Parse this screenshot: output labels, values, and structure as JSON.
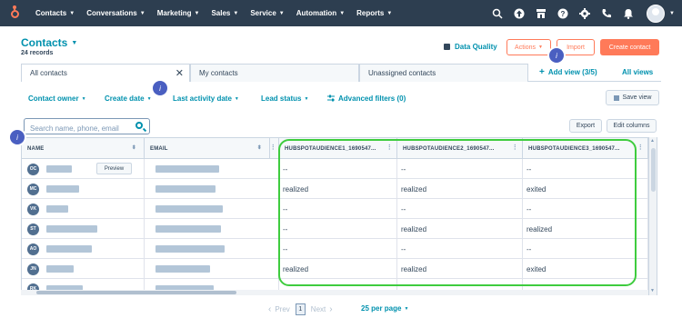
{
  "nav": {
    "items": [
      {
        "label": "Contacts"
      },
      {
        "label": "Conversations"
      },
      {
        "label": "Marketing"
      },
      {
        "label": "Sales"
      },
      {
        "label": "Service"
      },
      {
        "label": "Automation"
      },
      {
        "label": "Reports"
      }
    ],
    "icons": [
      "search-icon",
      "upgrade-icon",
      "marketplace-icon",
      "help-icon",
      "settings-icon",
      "calling-icon",
      "notifications-icon"
    ]
  },
  "header": {
    "title": "Contacts",
    "record_count": "24 records",
    "data_quality": "Data Quality",
    "actions": "Actions",
    "import": "Import",
    "create_contact": "Create contact"
  },
  "tabs": [
    {
      "label": "All contacts",
      "active": true
    },
    {
      "label": "My contacts",
      "active": false
    },
    {
      "label": "Unassigned contacts",
      "active": false
    }
  ],
  "views": {
    "add_view": "Add view (3/5)",
    "all_views": "All views"
  },
  "filters": {
    "contact_owner": "Contact owner",
    "create_date": "Create date",
    "last_activity_date": "Last activity date",
    "lead_status": "Lead status",
    "advanced_filters": "Advanced filters (0)",
    "save_view": "Save view"
  },
  "search": {
    "placeholder": "Search name, phone, email"
  },
  "table_tools": {
    "export": "Export",
    "edit_columns": "Edit columns"
  },
  "table": {
    "columns": [
      "NAME",
      "EMAIL",
      "HUBSPOTAUDIENCE1_1690547...",
      "HUBSPOTAUDIENCE2_1690547...",
      "HUBSPOTAUDIENCE3_1690547..."
    ],
    "preview_label": "Preview",
    "rows": [
      {
        "initials": "OC",
        "a1": "--",
        "a2": "--",
        "a3": "--"
      },
      {
        "initials": "MC",
        "a1": "realized",
        "a2": "realized",
        "a3": "exited"
      },
      {
        "initials": "VK",
        "a1": "--",
        "a2": "--",
        "a3": "--"
      },
      {
        "initials": "ST",
        "a1": "--",
        "a2": "realized",
        "a3": "realized"
      },
      {
        "initials": "AO",
        "a1": "--",
        "a2": "--",
        "a3": "--"
      },
      {
        "initials": "JN",
        "a1": "realized",
        "a2": "realized",
        "a3": "exited"
      },
      {
        "initials": "RK",
        "a1": "",
        "a2": "",
        "a3": ""
      }
    ]
  },
  "pagination": {
    "prev": "Prev",
    "page": "1",
    "next": "Next",
    "per_page": "25 per page"
  },
  "info_marker": "i",
  "colors": {
    "nav_bg": "#2d3e50",
    "accent": "#ff7a59",
    "link": "#0091ae",
    "highlight": "#3ecc3e",
    "info_marker": "#4a5fc1"
  }
}
